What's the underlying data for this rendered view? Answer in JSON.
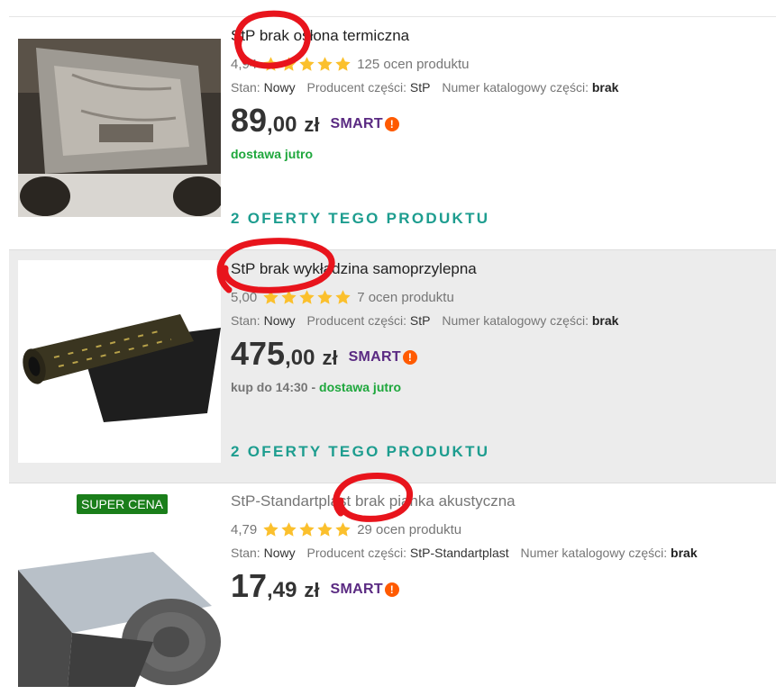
{
  "listings": [
    {
      "title": "StP brak osłona termiczna",
      "rating_value": "4,94",
      "rating_stars": 5,
      "rating_count": "125 ocen produktu",
      "param_stan_label": "Stan:",
      "param_stan_value": "Nowy",
      "param_prod_label": "Producent części:",
      "param_prod_value": "StP",
      "param_num_label": "Numer katalogowy części:",
      "param_num_value": "brak",
      "price_int": "89",
      "price_dec": ",00",
      "currency": "zł",
      "smart_label": "SMART",
      "delivery_prefix": "",
      "delivery_green": "dostawa jutro",
      "offers_label": "2 OFERTY TEGO PRODUKTU"
    },
    {
      "title": "StP brak wykładzina samoprzylepna",
      "rating_value": "5,00",
      "rating_stars": 5,
      "rating_count": "7 ocen produktu",
      "param_stan_label": "Stan:",
      "param_stan_value": "Nowy",
      "param_prod_label": "Producent części:",
      "param_prod_value": "StP",
      "param_num_label": "Numer katalogowy części:",
      "param_num_value": "brak",
      "price_int": "475",
      "price_dec": ",00",
      "currency": "zł",
      "smart_label": "SMART",
      "delivery_prefix": "kup do 14:30 - ",
      "delivery_green": "dostawa jutro",
      "offers_label": "2 OFERTY TEGO PRODUKTU"
    },
    {
      "badge": "SUPER CENA",
      "title": "StP-Standartplast brak pianka akustyczna",
      "rating_value": "4,79",
      "rating_stars": 5,
      "rating_count": "29 ocen produktu",
      "param_stan_label": "Stan:",
      "param_stan_value": "Nowy",
      "param_prod_label": "Producent części:",
      "param_prod_value": "StP-Standartplast",
      "param_num_label": "Numer katalogowy części:",
      "param_num_value": "brak",
      "price_int": "17",
      "price_dec": ",49",
      "currency": "zł",
      "smart_label": "SMART"
    }
  ],
  "colors": {
    "star": "#fbc02d",
    "offers": "#1d9d8f",
    "delivery_green": "#1ea73c",
    "smart_purple": "#5a2a82",
    "smart_orange": "#ff5a00",
    "badge_green": "#1a7e1a",
    "annotation_red": "#e8141c"
  },
  "icons": [
    "star-icon",
    "smart-exclamation-icon"
  ]
}
